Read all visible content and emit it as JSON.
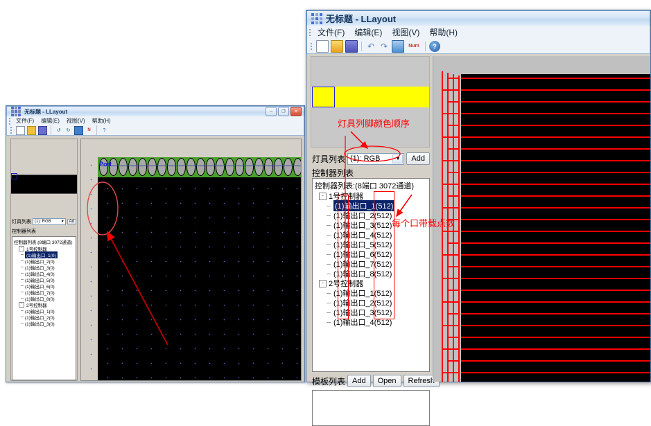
{
  "back_window": {
    "title": "无标题 - LLayout",
    "icon": "app-icon",
    "menus": [
      "文件(F)",
      "编辑(E)",
      "视图(V)",
      "帮助(H)"
    ],
    "toolbar": [
      "new-icon",
      "open-icon",
      "save-icon",
      "undo-icon",
      "redo-icon",
      "screen-icon",
      "num-icon",
      "help-icon"
    ],
    "window_buttons": {
      "minimize": "─",
      "maximize": "❐",
      "close": "✕"
    },
    "panel": {
      "lamp_list_label": "灯具列表",
      "lamp_list_value": "(1): RGB",
      "add_button": "Ad",
      "controller_group_label": "控制器列表",
      "tree_root": "控制器列表:(8端口 3072通道)",
      "controllers": [
        {
          "name": "1号控制器",
          "ports": [
            "(1)输出口_1(0)",
            "(1)输出口_2(0)",
            "(1)输出口_3(0)",
            "(1)输出口_4(0)",
            "(1)输出口_5(0)",
            "(1)输出口_6(0)",
            "(1)输出口_7(0)",
            "(1)输出口_8(0)"
          ]
        },
        {
          "name": "2号控制器",
          "ports": [
            "(1)输出口_1(0)",
            "(1)输出口_2(0)",
            "(1)输出口_3(0)"
          ]
        }
      ],
      "selected_port": "(1)输出口_1(0)"
    },
    "canvas": {
      "port_label": "Port"
    }
  },
  "front_window": {
    "title": "无标题 - LLayout",
    "icon": "app-icon",
    "menus": [
      "文件(F)",
      "编辑(E)",
      "视图(V)",
      "帮助(H)"
    ],
    "toolbar": [
      "new-icon",
      "open-icon",
      "save-icon",
      "undo-icon",
      "redo-icon",
      "screen-icon",
      "num-icon",
      "help-icon"
    ],
    "toolbar_num_label": "Num",
    "window_buttons": {
      "minimize": "─",
      "maximize": "❐",
      "close": "✕"
    },
    "panel": {
      "lamp_list_label": "灯具列表",
      "lamp_list_value": "(1): RGB",
      "lamp_list_options": [
        "(1): RGB"
      ],
      "add_button": "Add",
      "controller_group_label": "控制器列表",
      "tree_root": "控制器列表:(8端口 3072通道)",
      "controllers": [
        {
          "name": "1号控制器",
          "ports": [
            "(1)输出口_1(512)",
            "(1)输出口_2(512)",
            "(1)输出口_3(512)",
            "(1)输出口_4(512)",
            "(1)输出口_5(512)",
            "(1)输出口_6(512)",
            "(1)输出口_7(512)",
            "(1)输出口_8(512)"
          ]
        },
        {
          "name": "2号控制器",
          "ports": [
            "(1)输出口_1(512)",
            "(1)输出口_2(512)",
            "(1)输出口_3(512)",
            "(1)输出口_4(512)"
          ]
        }
      ],
      "selected_port": "(1)输出口_1(512)",
      "template_label": "模板列表",
      "template_buttons": [
        "Add",
        "Open",
        "Refresh"
      ]
    }
  },
  "annotations": {
    "lamp_color_order": "灯具列脚颜色顺序",
    "points_per_port": "每个口带载点数"
  },
  "colors": {
    "annotation_red": "#ff0000",
    "selection_blue": "#0a246a",
    "highlight_yellow": "#ffff00",
    "canvas_black": "#000000",
    "lamp_green": "#4aa02c",
    "window_face": "#d4d0c8"
  }
}
